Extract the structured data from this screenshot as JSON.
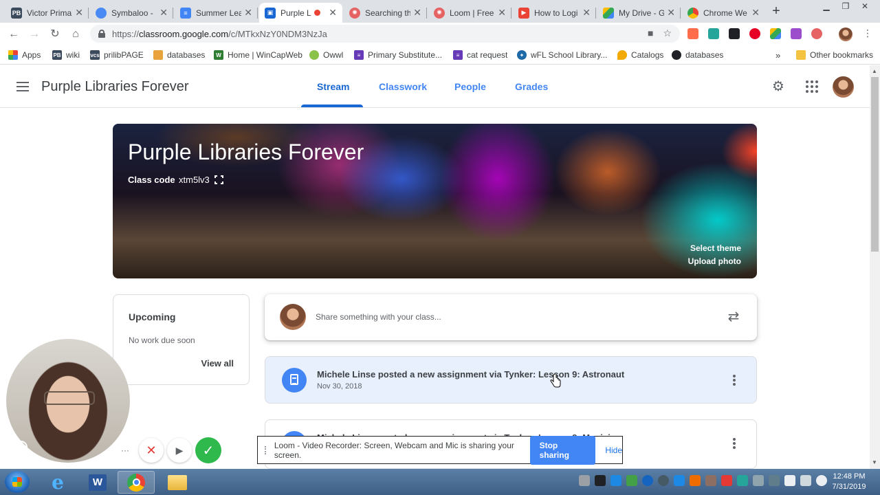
{
  "browser": {
    "tabs": [
      {
        "title": "Victor Prima",
        "color": "#3b4a5c",
        "icon": "PB",
        "active": false
      },
      {
        "title": "Symbaloo - ",
        "color": "#4a8af4",
        "icon": "globe",
        "active": false
      },
      {
        "title": "Summer Lea",
        "color": "#4285f4",
        "icon": "doc",
        "active": false
      },
      {
        "title": "Purple L",
        "color": "#1967d2",
        "icon": "classroom",
        "active": true,
        "recording": true
      },
      {
        "title": "Searching th",
        "color": "#e66363",
        "icon": "loom",
        "active": false
      },
      {
        "title": "Loom | Free",
        "color": "#e66363",
        "icon": "loom",
        "active": false
      },
      {
        "title": "How to Logi",
        "color": "#ea4335",
        "icon": "play",
        "active": false
      },
      {
        "title": "My Drive - G",
        "color": "#34a853",
        "icon": "drive",
        "active": false
      },
      {
        "title": "Chrome We",
        "color": "#fbbc04",
        "icon": "chrome",
        "active": false
      }
    ],
    "url": {
      "scheme": "https://",
      "host": "classroom.google.com",
      "path": "/c/MTkxNzY0NDM3NzJa"
    },
    "bookmarks": [
      {
        "label": "Apps",
        "color": "#ea4335",
        "icon": "apps"
      },
      {
        "label": "wiki",
        "color": "#3b4a5c",
        "icon": "PB"
      },
      {
        "label": "prilibPAGE",
        "color": "#3b4a5c",
        "icon": "vcs"
      },
      {
        "label": "databases",
        "color": "#e8a33d",
        "icon": "folder"
      },
      {
        "label": "Home | WinCapWeb",
        "color": "#2e7d32",
        "icon": "W"
      },
      {
        "label": "Owwl",
        "color": "#8bc34a",
        "icon": "leaf"
      },
      {
        "label": "Primary Substitute...",
        "color": "#673ab7",
        "icon": "form"
      },
      {
        "label": "cat request",
        "color": "#673ab7",
        "icon": "form"
      },
      {
        "label": "wFL School Library...",
        "color": "#1e6aa8",
        "icon": "star"
      },
      {
        "label": "Catalogs",
        "color": "#f2a900",
        "icon": "drop"
      },
      {
        "label": "databases",
        "color": "#202124",
        "icon": "circle"
      }
    ],
    "other_bookmarks": "Other bookmarks"
  },
  "classroom": {
    "class_name": "Purple Libraries Forever",
    "nav_tabs": [
      {
        "label": "Stream",
        "active": true
      },
      {
        "label": "Classwork",
        "active": false
      },
      {
        "label": "People",
        "active": false
      },
      {
        "label": "Grades",
        "active": false
      }
    ],
    "banner": {
      "title": "Purple Libraries Forever",
      "class_code_label": "Class code",
      "class_code": "xtm5lv3",
      "select_theme": "Select theme",
      "upload_photo": "Upload photo"
    },
    "upcoming": {
      "title": "Upcoming",
      "empty": "No work due soon",
      "view_all": "View all"
    },
    "share_placeholder": "Share something with your class...",
    "posts": [
      {
        "text": "Michele Linse posted a new assignment via Tynker: Lesson 9: Astronaut",
        "date": "Nov 30, 2018"
      },
      {
        "text": "Michele Linse posted a new assignment via Tynker: Lesson 8: Magician",
        "date": ""
      }
    ]
  },
  "loom": {
    "message": "Loom - Video Recorder: Screen, Webcam and Mic is sharing your screen.",
    "stop_sharing": "Stop sharing",
    "hide": "Hide"
  },
  "taskbar": {
    "time": "12:48 PM",
    "date": "7/31/2019"
  },
  "colors": {
    "accent": "#1967d2",
    "tab_blue": "#4285f4",
    "loom_stop": "#4285f4",
    "loom_cancel": "#e53935",
    "loom_done": "#2fb94c"
  }
}
